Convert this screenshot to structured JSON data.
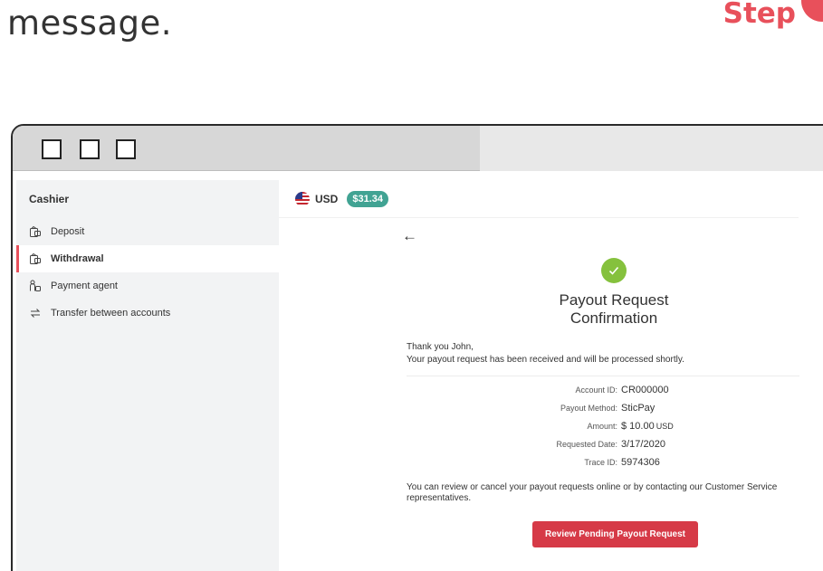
{
  "header": {
    "message": "message.",
    "step_label": "Step",
    "accent_color": "#e8505b"
  },
  "window": {
    "buttons": [
      "square-icon",
      "square-icon",
      "square-icon"
    ]
  },
  "sidebar": {
    "title": "Cashier",
    "items": [
      {
        "label": "Deposit",
        "icon": "wallet-icon",
        "active": false
      },
      {
        "label": "Withdrawal",
        "icon": "wallet-icon",
        "active": true
      },
      {
        "label": "Payment agent",
        "icon": "agent-icon",
        "active": false
      },
      {
        "label": "Transfer between accounts",
        "icon": "transfer-icon",
        "active": false
      }
    ]
  },
  "account": {
    "currency": "USD",
    "balance": "$31.34",
    "flag_icon": "us-flag-icon",
    "balance_color": "#41a393"
  },
  "confirmation": {
    "back_icon": "arrow-left-icon",
    "success_icon": "check-circle-icon",
    "success_color": "#85c13d",
    "title": "Payout Request Confirmation",
    "thanks_line1": "Thank you John,",
    "thanks_line2": "Your payout request has been received and will be processed shortly.",
    "details": [
      {
        "label": "Account ID:",
        "value": "CR000000",
        "unit": ""
      },
      {
        "label": "Payout Method:",
        "value": "SticPay",
        "unit": ""
      },
      {
        "label": "Amount:",
        "value": "$ 10.00",
        "unit": "USD"
      },
      {
        "label": "Requested Date:",
        "value": "3/17/2020",
        "unit": ""
      },
      {
        "label": "Trace ID:",
        "value": "5974306",
        "unit": ""
      }
    ],
    "note": "You can review or cancel your payout requests online or by contacting our Customer Service representatives.",
    "button_label": "Review Pending Payout Request",
    "button_color": "#d63a47"
  }
}
